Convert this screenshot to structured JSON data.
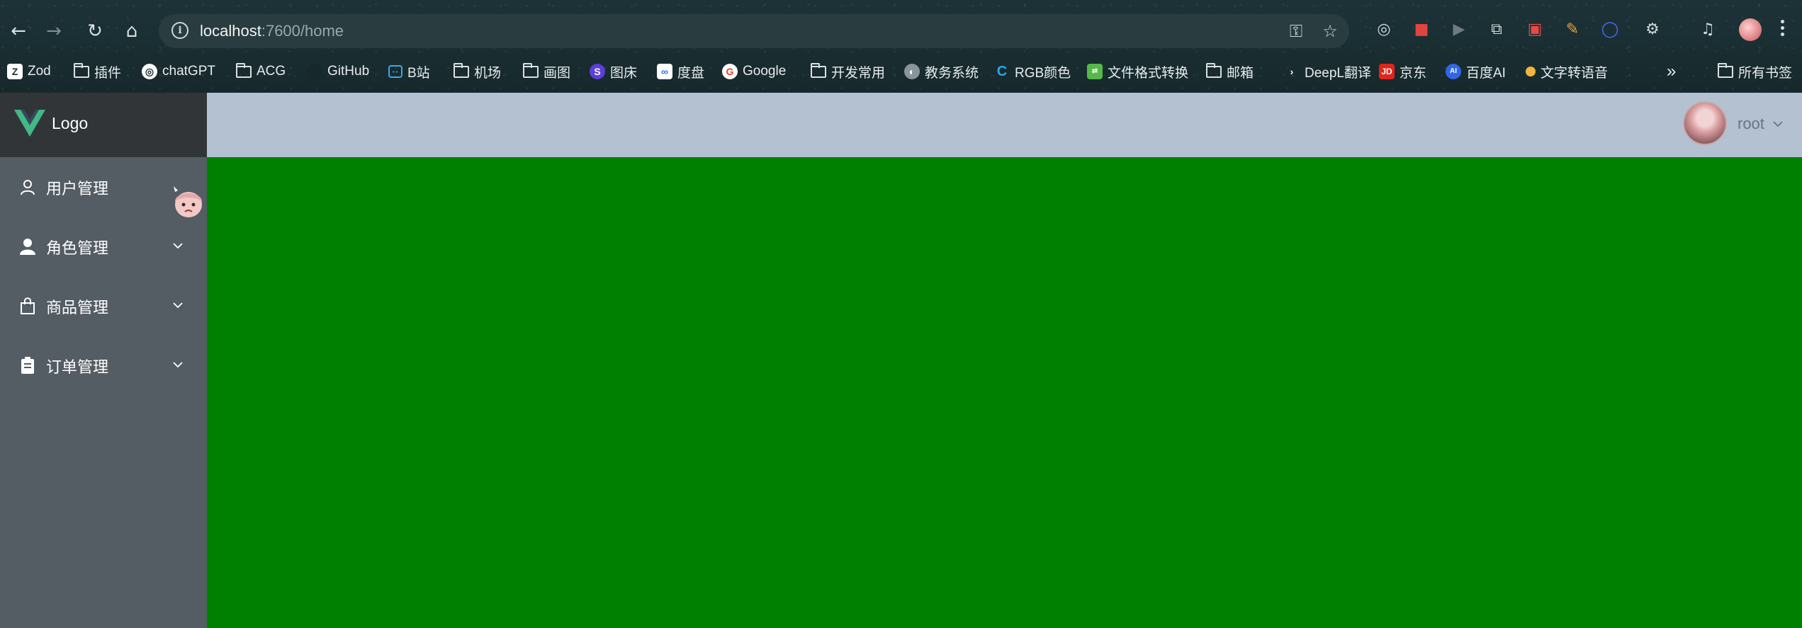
{
  "browser": {
    "url_host": "localhost",
    "url_path": ":7600/home",
    "nav_icons": [
      "back-arrow-icon",
      "forward-arrow-icon",
      "reload-icon",
      "home-icon"
    ],
    "omnibox_icons": [
      "site-info-icon",
      "password-key-icon",
      "bookmark-star-icon"
    ],
    "bookmarks": [
      {
        "label": "Zod",
        "icon": "zod-icon"
      },
      {
        "label": "插件",
        "icon": "folder-icon"
      },
      {
        "label": "chatGPT",
        "icon": "openai-icon"
      },
      {
        "label": "ACG",
        "icon": "folder-icon"
      },
      {
        "label": "GitHub",
        "icon": "github-icon"
      },
      {
        "label": "B站",
        "icon": "bilibili-icon"
      },
      {
        "label": "机场",
        "icon": "folder-icon"
      },
      {
        "label": "画图",
        "icon": "folder-icon"
      },
      {
        "label": "图床",
        "icon": "image-host-icon"
      },
      {
        "label": "度盘",
        "icon": "baidu-pan-icon"
      },
      {
        "label": "Google",
        "icon": "google-icon"
      },
      {
        "label": "开发常用",
        "icon": "folder-icon"
      },
      {
        "label": "教务系统",
        "icon": "globe-icon"
      },
      {
        "label": "RGB颜色",
        "icon": "rgb-icon"
      },
      {
        "label": "文件格式转换",
        "icon": "file-convert-icon"
      },
      {
        "label": "邮箱",
        "icon": "folder-icon"
      },
      {
        "label": "DeepL翻译",
        "icon": "deepl-icon"
      },
      {
        "label": "京东",
        "icon": "jd-icon"
      },
      {
        "label": "百度AI",
        "icon": "baidu-ai-icon"
      },
      {
        "label": "文字转语音",
        "icon": "tts-icon"
      }
    ],
    "bookmarks_overflow": "»",
    "all_bookmarks": "所有书签"
  },
  "app": {
    "logo_text": "Logo",
    "menu": [
      {
        "label": "用户管理",
        "icon": "user-outline-icon",
        "has_submenu": false
      },
      {
        "label": "角色管理",
        "icon": "user-filled-icon",
        "has_submenu": true
      },
      {
        "label": "商品管理",
        "icon": "shopping-bag-icon",
        "has_submenu": true
      },
      {
        "label": "订单管理",
        "icon": "clipboard-icon",
        "has_submenu": true
      }
    ],
    "user": {
      "name": "root"
    },
    "colors": {
      "sidebar": "#545c64",
      "logo_bar": "#313538",
      "header": "#b3c1d1",
      "content": "#008000",
      "vue_green": "#42b883"
    }
  }
}
